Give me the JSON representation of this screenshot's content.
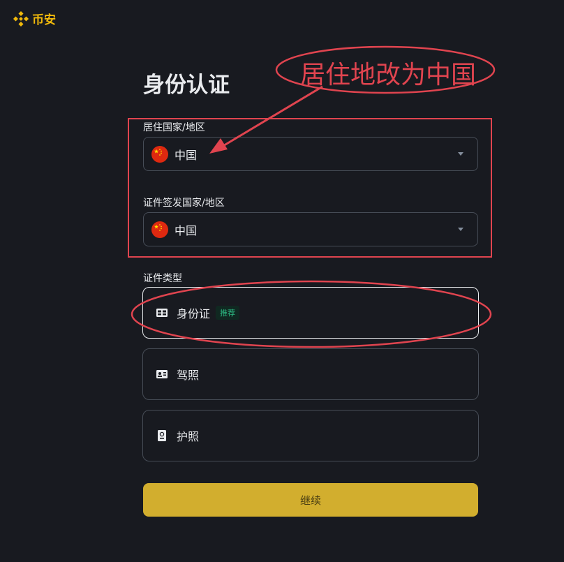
{
  "brand": {
    "name": "币安",
    "color": "#f0b90b",
    "logo_icon": "binance-diamond-icon"
  },
  "page": {
    "title": "身份认证"
  },
  "residence": {
    "label": "居住国家/地区",
    "value": "中国",
    "flag_icon": "china-flag-icon"
  },
  "issuing": {
    "label": "证件签发国家/地区",
    "value": "中国",
    "flag_icon": "china-flag-icon"
  },
  "doc_type": {
    "label": "证件类型",
    "options": [
      {
        "label": "身份证",
        "badge": "推荐",
        "icon": "id-card-icon",
        "selected": true
      },
      {
        "label": "驾照",
        "icon": "driver-license-icon",
        "selected": false
      },
      {
        "label": "护照",
        "icon": "passport-icon",
        "selected": false
      }
    ]
  },
  "actions": {
    "continue_label": "继续"
  },
  "annotation": {
    "text": "居住地改为中国",
    "color": "#e0444f"
  }
}
